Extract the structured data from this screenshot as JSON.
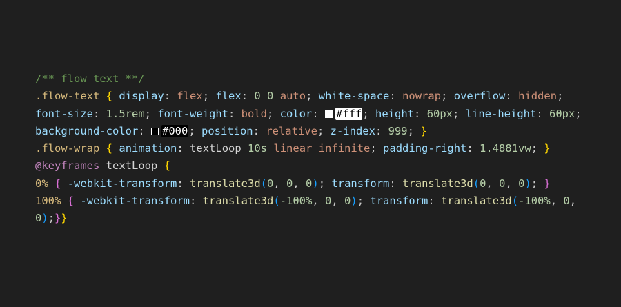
{
  "colors": {
    "background": "#1f1f1f",
    "comment": "#6a9955",
    "selector": "#d7ba7d",
    "property": "#9cdcfe",
    "value": "#ce9178",
    "number": "#b5cea8",
    "at_rule": "#c586c0",
    "function": "#dcdcaa",
    "brace": "#ffd700",
    "swatch_white": "#ffffff",
    "swatch_black": "#000000"
  },
  "code": {
    "line1": {
      "comment": "/** flow text **/"
    },
    "line2": {
      "selector": ".flow-text",
      "open": "{",
      "p1": "display",
      "v1": "flex",
      "p2": "flex",
      "v2a": "0",
      "v2b": "0",
      "v2c": "auto",
      "p3": "white-space",
      "v3": "nowrap",
      "p4": "overflow",
      "v4": "hidden"
    },
    "line3": {
      "p1": "font-size",
      "v1": "1.5rem",
      "p2": "font-weight",
      "v2": "bold",
      "p3": "color",
      "v3": "#fff",
      "p4": "height",
      "v4": "60px",
      "p5": "line-height",
      "v5": "60px"
    },
    "line4": {
      "p1": "background-color",
      "v1": "#000",
      "p2": "position",
      "v2": "relative",
      "p3": "z-index",
      "v3": "999",
      "close": "}"
    },
    "line5": {
      "selector": ".flow-wrap",
      "open": "{",
      "p1": "animation",
      "v1a": "textLoop",
      "v1b": "10s",
      "v1c": "linear",
      "v1d": "infinite",
      "p2": "padding-right",
      "v2": "1.4881vw",
      "close": "}"
    },
    "line6": {
      "at": "@keyframes",
      "name": "textLoop",
      "open": "{"
    },
    "line7": {
      "sel": "0%",
      "open": "{",
      "p1": "-webkit-transform",
      "fn1": "translate3d",
      "a1": "0",
      "a2": "0",
      "a3": "0",
      "p2": "transform",
      "fn2": "translate3d",
      "b1": "0",
      "b2": "0",
      "b3": "0",
      "close": "}"
    },
    "line8": {
      "sel": "100%",
      "open": "{",
      "p1": "-webkit-transform",
      "fn1": "translate3d",
      "a1": "-100%",
      "a2": "0",
      "a3": "0",
      "p2": "transform",
      "fn2": "translate3d",
      "b1": "-100%",
      "b2": "0"
    },
    "line9": {
      "b3": "0",
      "close_inner": "}",
      "close_outer": "}"
    }
  }
}
